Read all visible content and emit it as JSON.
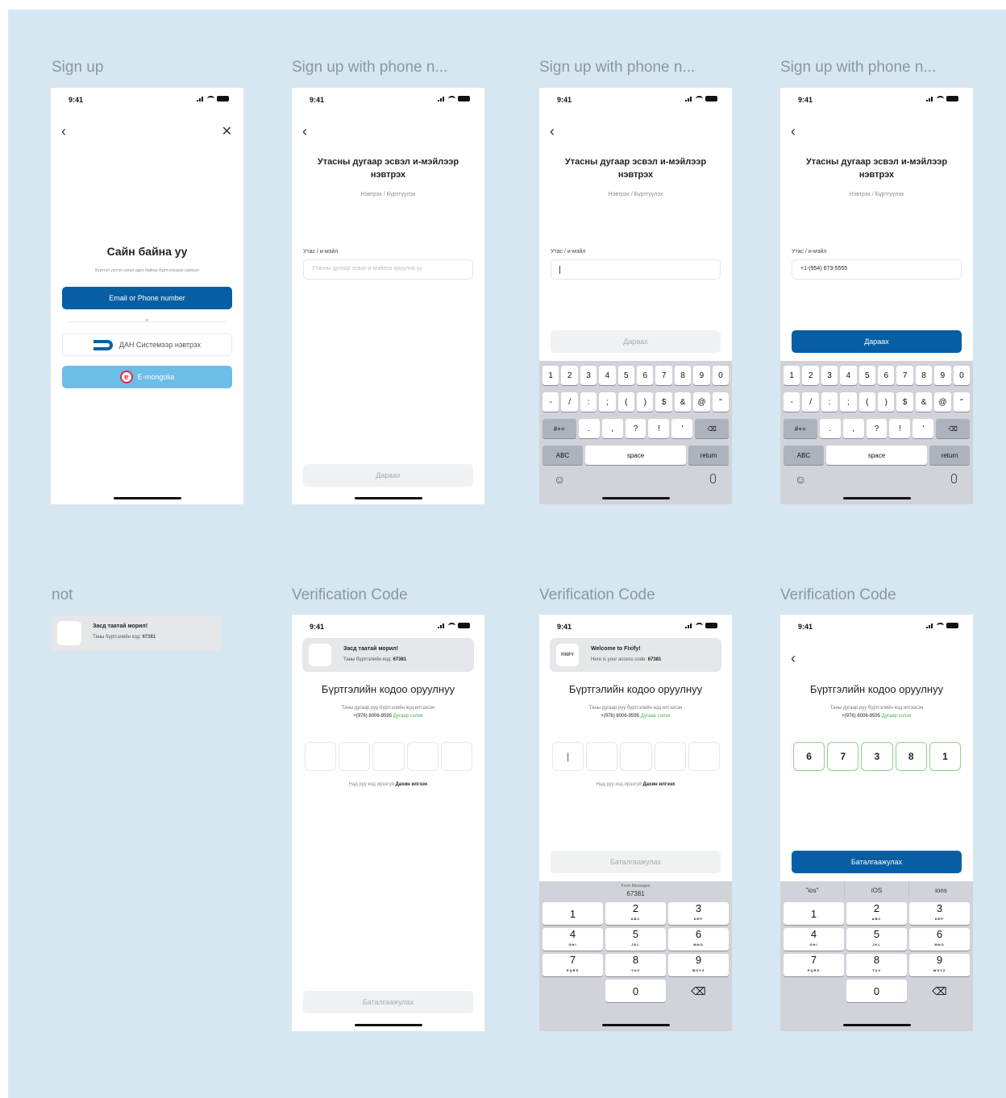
{
  "titles": {
    "f1": "Sign up",
    "f2": "Sign up with phone n...",
    "f3": "Sign up with phone n...",
    "f4": "Sign up with phone n...",
    "f5": "not",
    "f6": "Verification Code",
    "f7": "Verification Code",
    "f8": "Verification Code"
  },
  "status": {
    "time": "9:41"
  },
  "icons": {
    "back": "‹",
    "close": "✕",
    "mic": "🎙",
    "emoji": "☺",
    "delete": "⌫"
  },
  "signup": {
    "greeting": "Сайн байна уу",
    "subtitle": "Бүртгэл үүсгэх эсвэл одоо байгаа бүртгэлээрээ нэвтрэх",
    "email_phone_btn": "Email or Phone number",
    "or": "or",
    "dan_btn": "ДАН Системээр нэвтрэх",
    "emongolia_btn": "E-mongolia",
    "emongolia_logo": "e"
  },
  "phone_login": {
    "title": "Утасны дугаар эсвэл и-мэйлээр нэвтрэх",
    "subtitle": "Нэвтрэх / Бүртгүүлэх",
    "field_label": "Утас / и-мэйл",
    "placeholder": "Утасны дугаар эсвэл и-мэйлээ оруулна уу",
    "value": "+1-(954) 673-5555",
    "next_btn": "Дараах"
  },
  "keyboard": {
    "row1": [
      "1",
      "2",
      "3",
      "4",
      "5",
      "6",
      "7",
      "8",
      "9",
      "0"
    ],
    "row2": [
      "-",
      "/",
      ":",
      ";",
      "(",
      ")",
      "$",
      "&",
      "@",
      "\""
    ],
    "row3": [
      "#+=",
      ".",
      ",",
      "?",
      "!",
      "'",
      "⌫"
    ],
    "abc": "ABC",
    "space": "space",
    "return": "return"
  },
  "numpad": {
    "keys": [
      {
        "n": "1",
        "l": ""
      },
      {
        "n": "2",
        "l": "ABC"
      },
      {
        "n": "3",
        "l": "DEF"
      },
      {
        "n": "4",
        "l": "GHI"
      },
      {
        "n": "5",
        "l": "JKL"
      },
      {
        "n": "6",
        "l": "MNO"
      },
      {
        "n": "7",
        "l": "PQRS"
      },
      {
        "n": "8",
        "l": "TUV"
      },
      {
        "n": "9",
        "l": "WXYZ"
      }
    ],
    "zero": "0",
    "suggest_code_label": "From Messages",
    "suggest_code": "67381",
    "suggest": [
      "\"ios\"",
      "iOS",
      "ions"
    ]
  },
  "notification_mn": {
    "title": "Засд таатай морил!",
    "body_prefix": "Таны бүртгэлийн код:",
    "code": "67381"
  },
  "notification_en": {
    "app": "FIXIFY",
    "title": "Welcome to Fixify!",
    "body_prefix": "Here is your access code:",
    "code": "67381"
  },
  "verify": {
    "title": "Бүртгэлийн кодоо оруулнуу",
    "sub_line1": "Таны дугаар руу бүртгэлийн код илгээсэн",
    "phone": "+(976) 8006-9595",
    "change": "Дугаар солих",
    "resend_prefix": "Над руу код ирээгүй",
    "resend_link": "Дахин илгээх",
    "confirm_btn": "Баталгаажулах",
    "digits": [
      "6",
      "7",
      "3",
      "8",
      "1"
    ],
    "caret": "|"
  }
}
